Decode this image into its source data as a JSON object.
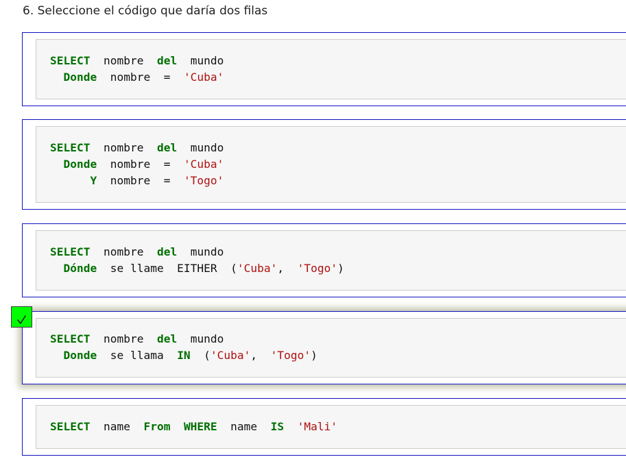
{
  "question": {
    "title": "6. Seleccione el código que daría dos filas"
  },
  "options": [
    {
      "lines": [
        [
          {
            "t": "SELECT",
            "k": "kw"
          },
          {
            "t": "  nombre  "
          },
          {
            "t": "del",
            "k": "kw"
          },
          {
            "t": "  mundo"
          }
        ],
        [
          {
            "t": "  "
          },
          {
            "t": "Donde",
            "k": "kw"
          },
          {
            "t": "  nombre  =  "
          },
          {
            "t": "'Cuba'",
            "k": "str"
          }
        ]
      ],
      "selected": false
    },
    {
      "lines": [
        [
          {
            "t": "SELECT",
            "k": "kw"
          },
          {
            "t": "  nombre  "
          },
          {
            "t": "del",
            "k": "kw"
          },
          {
            "t": "  mundo"
          }
        ],
        [
          {
            "t": "  "
          },
          {
            "t": "Donde",
            "k": "kw"
          },
          {
            "t": "  nombre  =  "
          },
          {
            "t": "'Cuba'",
            "k": "str"
          }
        ],
        [
          {
            "t": "      "
          },
          {
            "t": "Y",
            "k": "kw"
          },
          {
            "t": "  nombre  =  "
          },
          {
            "t": "'Togo'",
            "k": "str"
          }
        ]
      ],
      "selected": false
    },
    {
      "lines": [
        [
          {
            "t": "SELECT",
            "k": "kw"
          },
          {
            "t": "  nombre  "
          },
          {
            "t": "del",
            "k": "kw"
          },
          {
            "t": "  mundo"
          }
        ],
        [
          {
            "t": "  "
          },
          {
            "t": "Dónde",
            "k": "kw"
          },
          {
            "t": "  se llame  EITHER  ("
          },
          {
            "t": "'Cuba'",
            "k": "str"
          },
          {
            "t": ",  "
          },
          {
            "t": "'Togo'",
            "k": "str"
          },
          {
            "t": ")"
          }
        ]
      ],
      "selected": false
    },
    {
      "lines": [
        [
          {
            "t": "SELECT",
            "k": "kw"
          },
          {
            "t": "  nombre  "
          },
          {
            "t": "del",
            "k": "kw"
          },
          {
            "t": "  mundo"
          }
        ],
        [
          {
            "t": "  "
          },
          {
            "t": "Donde",
            "k": "kw"
          },
          {
            "t": "  se llama  "
          },
          {
            "t": "IN",
            "k": "kw"
          },
          {
            "t": "  ("
          },
          {
            "t": "'Cuba'",
            "k": "str"
          },
          {
            "t": ",  "
          },
          {
            "t": "'Togo'",
            "k": "str"
          },
          {
            "t": ")"
          }
        ]
      ],
      "selected": true
    },
    {
      "lines": [
        [
          {
            "t": "SELECT",
            "k": "kw"
          },
          {
            "t": "  name  "
          },
          {
            "t": "From",
            "k": "kw"
          },
          {
            "t": "  "
          },
          {
            "t": "WHERE",
            "k": "kw"
          },
          {
            "t": "  name  "
          },
          {
            "t": "IS",
            "k": "kw"
          },
          {
            "t": "  "
          },
          {
            "t": "'Mali'",
            "k": "str"
          }
        ]
      ],
      "selected": false
    }
  ],
  "selection_marker": {
    "icon": "checkmark-icon",
    "color": "#00ff00"
  },
  "colors": {
    "keyword": "#007000",
    "string": "#b01010",
    "option_border": "#1010c0",
    "code_background": "#f6f6f6"
  }
}
